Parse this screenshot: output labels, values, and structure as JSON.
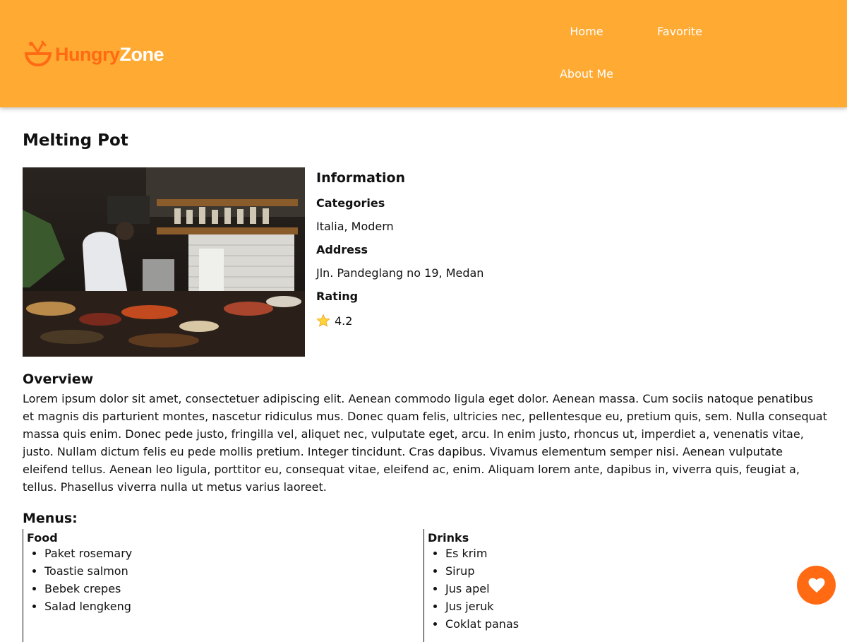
{
  "brand": {
    "part1": "Hungry",
    "part2": "Zone",
    "accent": "#FF6A13",
    "header_bg": "#FFAA33"
  },
  "nav": {
    "home": "Home",
    "favorite": "Favorite",
    "about": "About Me"
  },
  "restaurant": {
    "name": "Melting Pot",
    "info_heading": "Information",
    "categories_label": "Categories",
    "categories": "Italia, Modern",
    "address_label": "Address",
    "address": "Jln. Pandeglang no 19, Medan",
    "rating_label": "Rating",
    "rating_icon": "star-icon",
    "rating": "4.2"
  },
  "overview": {
    "heading": "Overview",
    "text": "Lorem ipsum dolor sit amet, consectetuer adipiscing elit. Aenean commodo ligula eget dolor. Aenean massa. Cum sociis natoque penatibus et magnis dis parturient montes, nascetur ridiculus mus. Donec quam felis, ultricies nec, pellentesque eu, pretium quis, sem. Nulla consequat massa quis enim. Donec pede justo, fringilla vel, aliquet nec, vulputate eget, arcu. In enim justo, rhoncus ut, imperdiet a, venenatis vitae, justo. Nullam dictum felis eu pede mollis pretium. Integer tincidunt. Cras dapibus. Vivamus elementum semper nisi. Aenean vulputate eleifend tellus. Aenean leo ligula, porttitor eu, consequat vitae, eleifend ac, enim. Aliquam lorem ante, dapibus in, viverra quis, feugiat a, tellus. Phasellus viverra nulla ut metus varius laoreet."
  },
  "menus": {
    "heading": "Menus:",
    "food": {
      "label": "Food",
      "items": [
        "Paket rosemary",
        "Toastie salmon",
        "Bebek crepes",
        "Salad lengkeng"
      ]
    },
    "drinks": {
      "label": "Drinks",
      "items": [
        "Es krim",
        "Sirup",
        "Jus apel",
        "Jus jeruk",
        "Coklat panas"
      ]
    }
  },
  "favorite_button": {
    "icon": "heart-icon"
  }
}
